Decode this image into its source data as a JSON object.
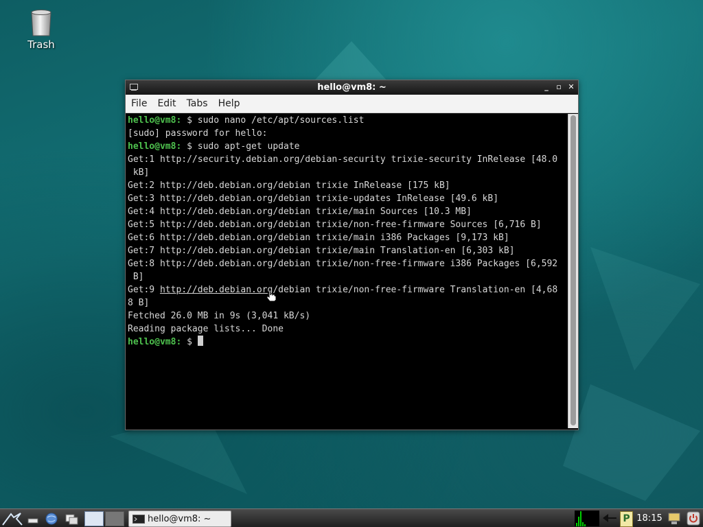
{
  "desktop": {
    "icons": [
      {
        "label": "Trash",
        "icon": "trash-icon"
      }
    ]
  },
  "window": {
    "title": "hello@vm8: ~",
    "menu": [
      "File",
      "Edit",
      "Tabs",
      "Help"
    ]
  },
  "terminal": {
    "prompt_user": "hello@vm8:",
    "lines": [
      {
        "type": "prompt",
        "command": "$ sudo nano /etc/apt/sources.list"
      },
      {
        "type": "output",
        "text": "[sudo] password for hello:"
      },
      {
        "type": "prompt",
        "command": "$ sudo apt-get update"
      },
      {
        "type": "output",
        "text": "Get:1 http://security.debian.org/debian-security trixie-security InRelease [48.0"
      },
      {
        "type": "output",
        "text": " kB]"
      },
      {
        "type": "output",
        "text": "Get:2 http://deb.debian.org/debian trixie InRelease [175 kB]"
      },
      {
        "type": "output",
        "text": "Get:3 http://deb.debian.org/debian trixie-updates InRelease [49.6 kB]"
      },
      {
        "type": "output",
        "text": "Get:4 http://deb.debian.org/debian trixie/main Sources [10.3 MB]"
      },
      {
        "type": "output",
        "text": "Get:5 http://deb.debian.org/debian trixie/non-free-firmware Sources [6,716 B]"
      },
      {
        "type": "output",
        "text": "Get:6 http://deb.debian.org/debian trixie/main i386 Packages [9,173 kB]"
      },
      {
        "type": "output",
        "text": "Get:7 http://deb.debian.org/debian trixie/main Translation-en [6,303 kB]"
      },
      {
        "type": "output",
        "text": "Get:8 http://deb.debian.org/debian trixie/non-free-firmware i386 Packages [6,592"
      },
      {
        "type": "output",
        "text": " B]"
      },
      {
        "type": "link_line",
        "prefix": "Get:9 ",
        "link": "http://deb.debian.org",
        "suffix": "/debian trixie/non-free-firmware Translation-en [4,68"
      },
      {
        "type": "output",
        "text": "8 B]"
      },
      {
        "type": "output",
        "text": "Fetched 26.0 MB in 9s (3,041 kB/s)"
      },
      {
        "type": "output",
        "text": "Reading package lists... Done"
      },
      {
        "type": "prompt",
        "command": "$ ",
        "cursor": true
      }
    ]
  },
  "taskbar": {
    "task_label": "hello@vm8: ~",
    "clock": "18:15",
    "tray_p_label": "P",
    "colors": {
      "accent_green": "#4ec24e",
      "taskbar": "#2a2a2a"
    }
  }
}
